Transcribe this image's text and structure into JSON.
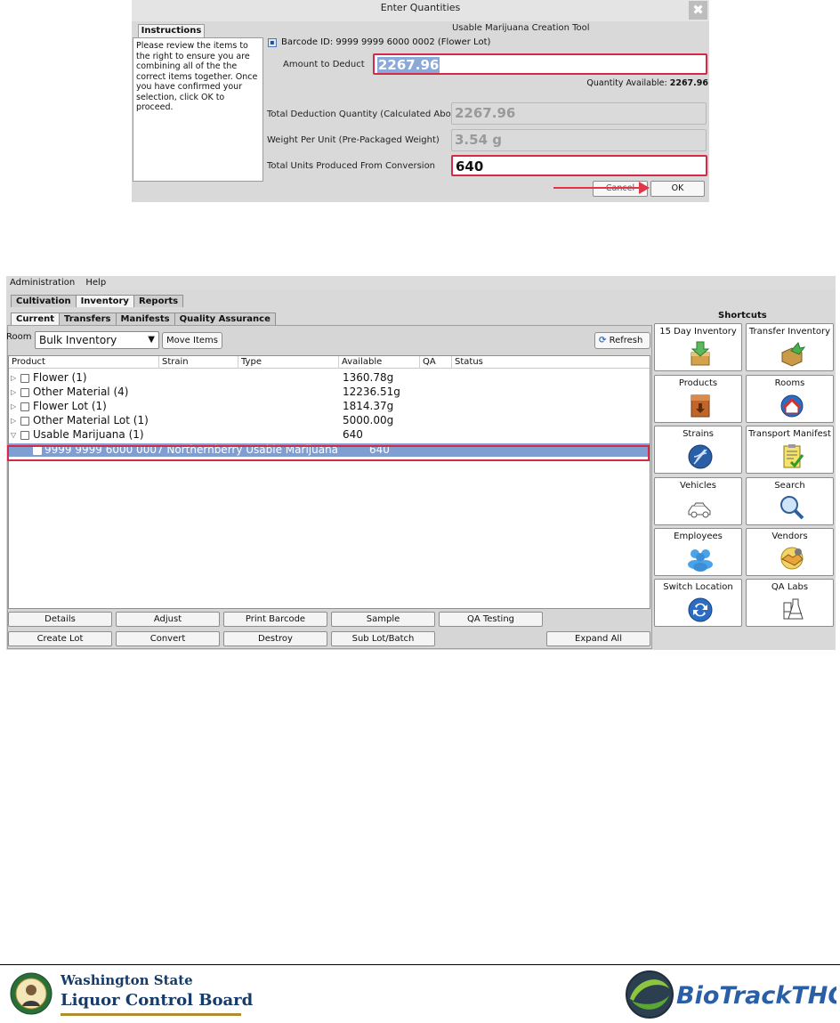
{
  "dialog": {
    "title": "Enter Quantities",
    "close_glyph": "✖",
    "instructions_tab": "Instructions",
    "instructions_text": "Please review the items to the right to ensure you are combining all of the the correct items together. Once you have confirmed your selection, click OK to proceed.",
    "tool_title": "Usable Marijuana Creation Tool",
    "barcode_label": "Barcode ID: 9999 9999 6000 0002 (Flower Lot)",
    "amount_label": "Amount to Deduct",
    "amount_value": "2267.96",
    "quantity_available_label": "Quantity Available:",
    "quantity_available_value": "2267.96",
    "total_deduction_label": "Total Deduction Quantity (Calculated Above)",
    "total_deduction_value": "2267.96",
    "weight_label": "Weight Per Unit (Pre-Packaged Weight)",
    "weight_value": "3.54 g",
    "units_label": "Total Units Produced From Conversion",
    "units_value": "640",
    "cancel_label": "Cancel",
    "ok_label": "OK"
  },
  "menu": [
    "Administration",
    "Help"
  ],
  "top_tabs": [
    "Cultivation",
    "Inventory",
    "Reports"
  ],
  "sub_tabs": [
    "Current",
    "Transfers",
    "Manifests",
    "Quality Assurance"
  ],
  "room": {
    "label": "Room",
    "selected": "Bulk Inventory",
    "move_items": "Move Items",
    "refresh": "Refresh"
  },
  "table": {
    "columns": [
      "Product",
      "Strain",
      "Type",
      "Available",
      "QA",
      "Status"
    ],
    "rows": [
      {
        "twisty": "▷",
        "name": "Flower (1)",
        "available": "1360.78g"
      },
      {
        "twisty": "▷",
        "name": "Other Material (4)",
        "available": "12236.51g"
      },
      {
        "twisty": "▷",
        "name": "Flower Lot (1)",
        "available": "1814.37g"
      },
      {
        "twisty": "▷",
        "name": "Other Material Lot (1)",
        "available": "5000.00g"
      },
      {
        "twisty": "▽",
        "name": "Usable Marijuana (1)",
        "available": "640"
      }
    ],
    "selected_row": {
      "name": "9999 9999 6000 0007 Northernberry Usable Marijuana",
      "available": "640"
    }
  },
  "bottom_buttons_row1": [
    "Details",
    "Adjust",
    "Print Barcode",
    "Sample",
    "QA Testing"
  ],
  "bottom_buttons_row2": [
    "Create Lot",
    "Convert",
    "Destroy",
    "Sub Lot/Batch"
  ],
  "expand_all": "Expand All",
  "shortcuts": {
    "title": "Shortcuts",
    "items": [
      "15 Day Inventory",
      "Transfer Inventory",
      "Products",
      "Rooms",
      "Strains",
      "Transport Manifest",
      "Vehicles",
      "Search",
      "Employees",
      "Vendors",
      "Switch Location",
      "QA Labs"
    ]
  },
  "footer": {
    "wa_line1": "Washington State",
    "wa_line2": "Liquor Control Board",
    "biotrack": "BioTrackTHC"
  },
  "colors": {
    "highlight": "#d62945",
    "selection": "#7f9fd2",
    "arrow": "#e2354a"
  }
}
